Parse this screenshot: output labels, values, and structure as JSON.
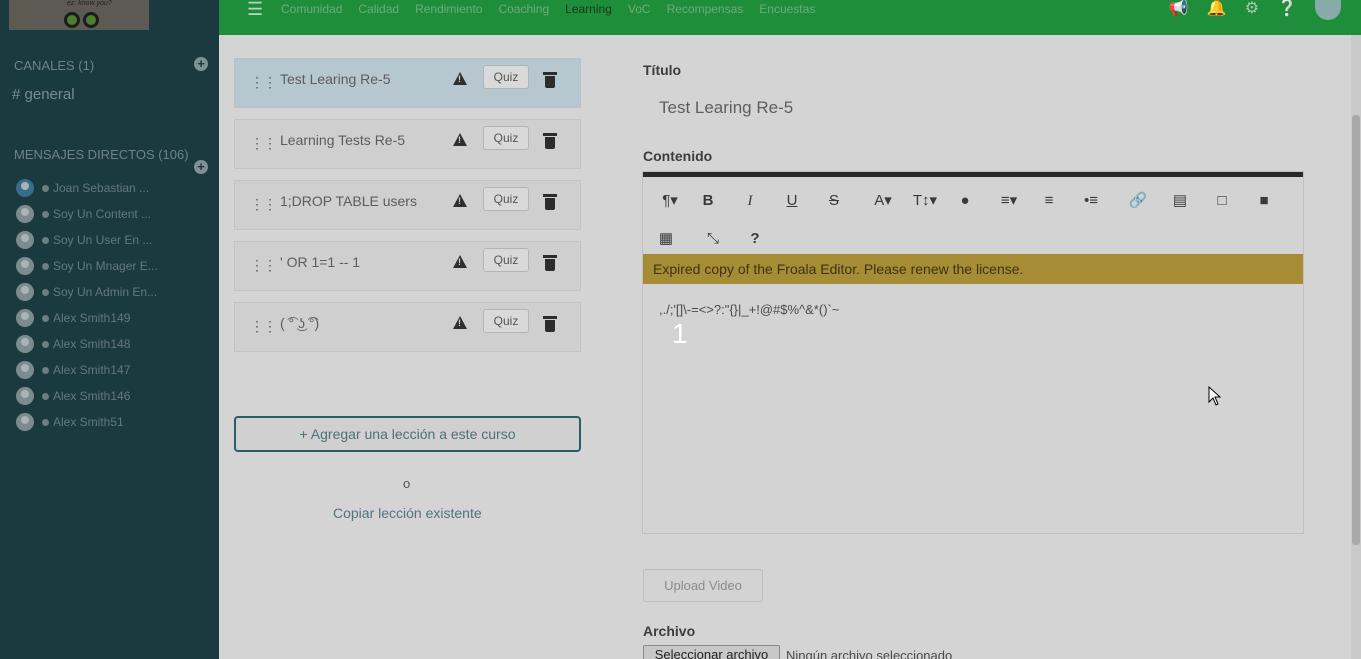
{
  "topbar": {
    "nav": [
      "Comunidad",
      "Calidad",
      "Rendimiento",
      "Coaching",
      "Learning",
      "VoC",
      "Recompensas",
      "Encuestas"
    ],
    "active_nav": "Learning"
  },
  "logo": {
    "tagline": "ez: know you?"
  },
  "sidebar": {
    "channels_title": "CANALES (1)",
    "channel": "# general",
    "dms_title": "MENSAJES DIRECTOS (106)",
    "dms": [
      "Joan Sebastian ...",
      "Soy Un Content ...",
      "Soy Un User En ...",
      "Soy Un Mnager E...",
      "Soy Un Admin En...",
      "Alex Smith149",
      "Alex Smith148",
      "Alex Smith147",
      "Alex Smith146",
      "Alex Smith51"
    ]
  },
  "lessons": [
    {
      "title": "Test Learing Re-5",
      "quiz": "Quiz"
    },
    {
      "title": "Learning Tests Re-5",
      "quiz": "Quiz"
    },
    {
      "title": "1;DROP TABLE users",
      "quiz": "Quiz"
    },
    {
      "title": "' OR 1=1 -- 1",
      "quiz": "Quiz"
    },
    {
      "title": "( ͡° ͜ʖ ͡°)",
      "quiz": "Quiz"
    }
  ],
  "lesson_actions": {
    "add": "+ Agregar una lección a este curso",
    "or": "o",
    "copy": "Copiar lección existente"
  },
  "form": {
    "title_label": "Título",
    "title_value": "Test Learing Re-5",
    "content_label": "Contenido",
    "license_banner": "Expired copy of the Froala Editor. Please renew the license.",
    "content_line": ",./;'[]\\-=<>?:\"{}|_+!@#$%^&*()`~",
    "content_number": "1",
    "upload_button": "Upload Video",
    "file_label": "Archivo",
    "file_button": "Seleccionar archivo",
    "file_status": "Ningún archivo seleccionado"
  },
  "colors": {
    "topbar": "#1f8e3a",
    "sidebar": "#1b3a40",
    "license": "#a68d35"
  }
}
